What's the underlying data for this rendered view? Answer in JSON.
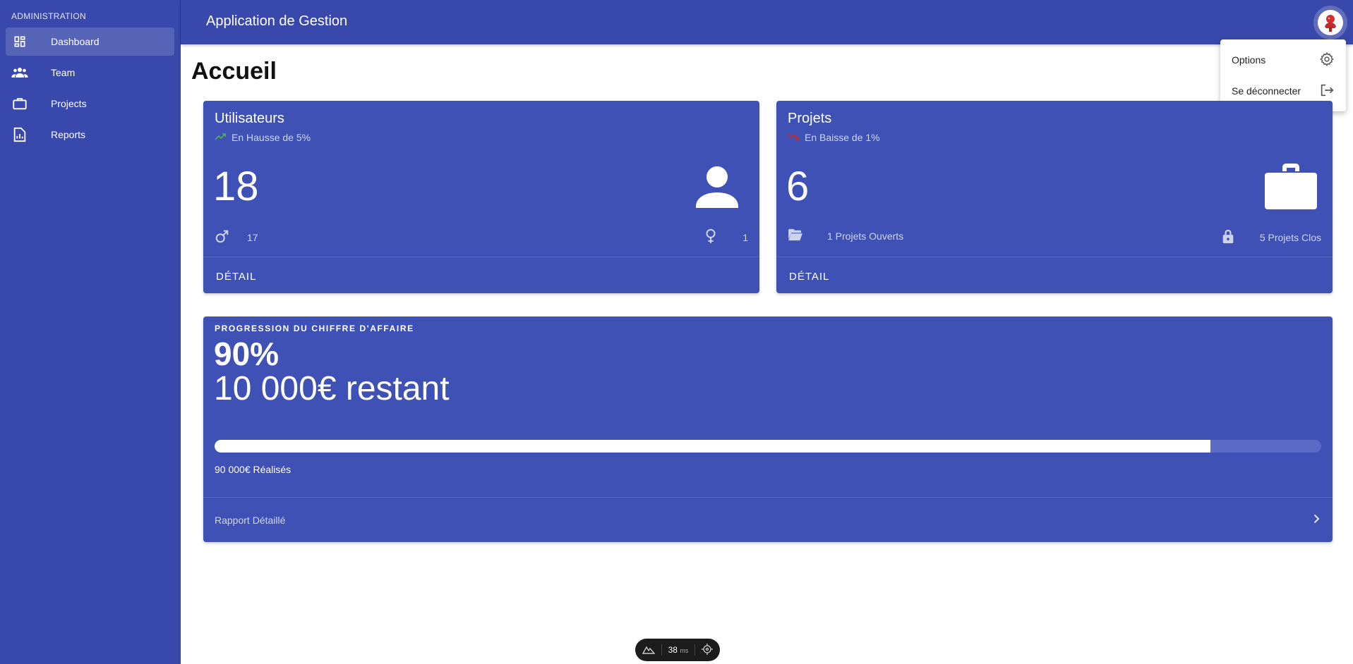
{
  "sidebar": {
    "section_title": "ADMINISTRATION",
    "items": [
      {
        "label": "Dashboard",
        "icon": "dashboard-icon",
        "active": true
      },
      {
        "label": "Team",
        "icon": "people-icon"
      },
      {
        "label": "Projects",
        "icon": "briefcase-icon"
      },
      {
        "label": "Reports",
        "icon": "report-icon"
      }
    ]
  },
  "header": {
    "app_title": "Application de Gestion",
    "avatar_icon": "avatar-icon"
  },
  "user_menu": {
    "items": [
      {
        "label": "Options",
        "icon": "gear-icon"
      },
      {
        "label": "Se déconnecter",
        "icon": "logout-icon"
      }
    ]
  },
  "main": {
    "page_title": "Accueil",
    "users_card": {
      "title": "Utilisateurs",
      "trend": "En Hausse de 5%",
      "trend_icon": "trending-up-icon",
      "trend_color": "#4caf50",
      "count": "18",
      "male_count": "17",
      "female_count": "1",
      "detail_label": "DÉTAIL"
    },
    "projects_card": {
      "title": "Projets",
      "trend": "En Baisse de 1%",
      "trend_icon": "trending-down-icon",
      "trend_color": "#c62828",
      "count": "6",
      "open_label": "1 Projets Ouverts",
      "closed_label": "5 Projets Clos",
      "detail_label": "DÉTAIL"
    },
    "revenue_card": {
      "overline": "PROGRESSION DU CHIFFRE D'AFFAIRE",
      "percent": "90%",
      "remaining": "10 000€ restant",
      "progress": 0.9,
      "achieved": "90 000€ Réalisés",
      "report_link": "Rapport Détaillé"
    }
  },
  "dev_toolbar": {
    "ms_value": "38",
    "ms_unit": "ms"
  },
  "colors": {
    "primary": "#3949ab",
    "card": "#3f51b5"
  }
}
